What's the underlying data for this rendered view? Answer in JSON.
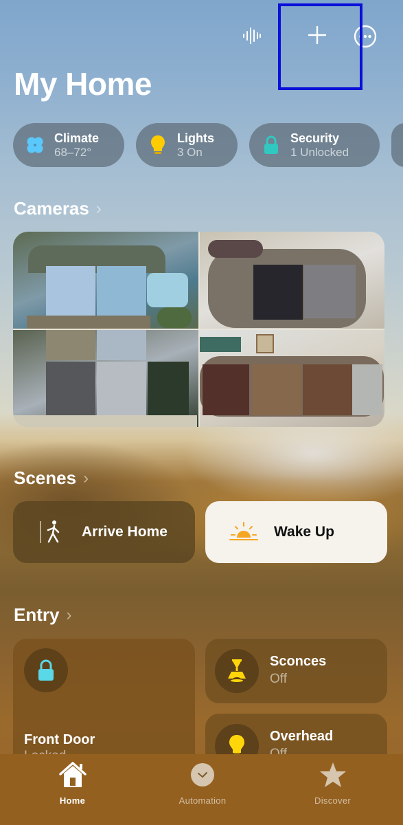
{
  "header": {
    "title": "My Home",
    "icons": {
      "voice": "waveform-icon",
      "add": "plus-icon",
      "more": "ellipsis-circle-icon"
    }
  },
  "status_chips": [
    {
      "label": "Climate",
      "value": "68–72°",
      "icon": "fan-icon",
      "color": "#5ac8fa"
    },
    {
      "label": "Lights",
      "value": "3 On",
      "icon": "lightbulb-icon",
      "color": "#ffcc00"
    },
    {
      "label": "Security",
      "value": "1 Unlocked",
      "icon": "lock-icon",
      "color": "#30c8c0"
    },
    {
      "label": "",
      "value": "",
      "icon": "partial-chip-icon"
    }
  ],
  "cameras": {
    "section_title": "Cameras",
    "chevron": "›",
    "feeds": [
      {
        "name": "camera-pool"
      },
      {
        "name": "camera-living-room"
      },
      {
        "name": "camera-yard"
      },
      {
        "name": "camera-hallway"
      }
    ]
  },
  "scenes": {
    "section_title": "Scenes",
    "chevron": "›",
    "items": [
      {
        "label": "Arrive Home",
        "icon": "walking-person-icon",
        "active": false
      },
      {
        "label": "Wake Up",
        "icon": "sunrise-icon",
        "active": true
      }
    ]
  },
  "entry": {
    "section_title": "Entry",
    "chevron": "›",
    "accessories": [
      {
        "name": "Front Door",
        "status": "Locked",
        "icon": "lock-icon",
        "color": "#5ad8e8"
      },
      {
        "name": "Sconces",
        "status": "Off",
        "icon": "sconce-lamp-icon",
        "color": "#ffd60a"
      },
      {
        "name": "Overhead",
        "status": "Off",
        "icon": "lightbulb-icon",
        "color": "#ffd60a"
      }
    ]
  },
  "tab_bar": {
    "tabs": [
      {
        "label": "Home",
        "icon": "house-icon",
        "active": true
      },
      {
        "label": "Automation",
        "icon": "clock-check-icon",
        "active": false
      },
      {
        "label": "Discover",
        "icon": "star-icon",
        "active": false
      }
    ]
  },
  "colors": {
    "highlight_box": "#0a10d8",
    "tab_bar_bg": "#94601f",
    "chip_bg": "#64737f"
  }
}
